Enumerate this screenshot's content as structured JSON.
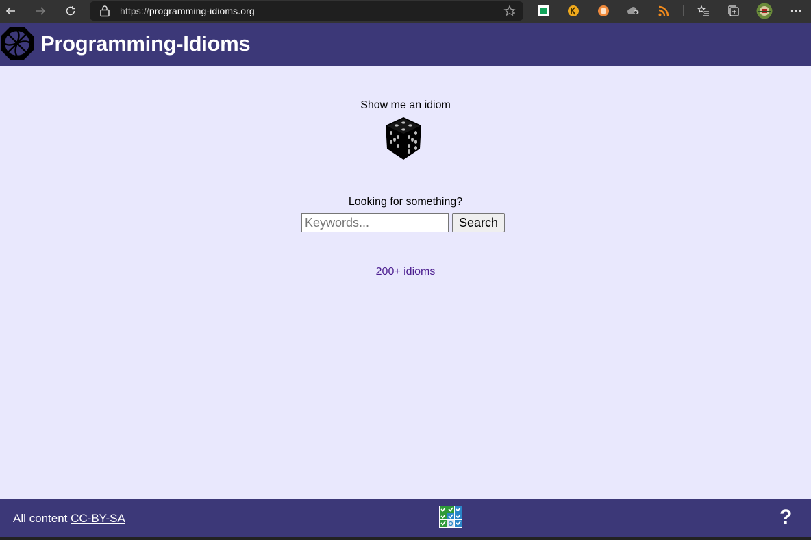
{
  "browser": {
    "url_scheme": "https://",
    "url_host": "programming-idioms.org"
  },
  "header": {
    "title": "Programming-Idioms"
  },
  "main": {
    "random_label": "Show me an idiom",
    "search_label": "Looking for something?",
    "search_placeholder": "Keywords...",
    "search_button": "Search",
    "idioms_link": "200+ idioms"
  },
  "footer": {
    "license_prefix": "All content",
    "license_link": "CC-BY-SA",
    "help_label": "?"
  },
  "colors": {
    "header_bg": "#3c3878",
    "main_bg": "#e9e8fd",
    "link": "#4b1d8f"
  }
}
